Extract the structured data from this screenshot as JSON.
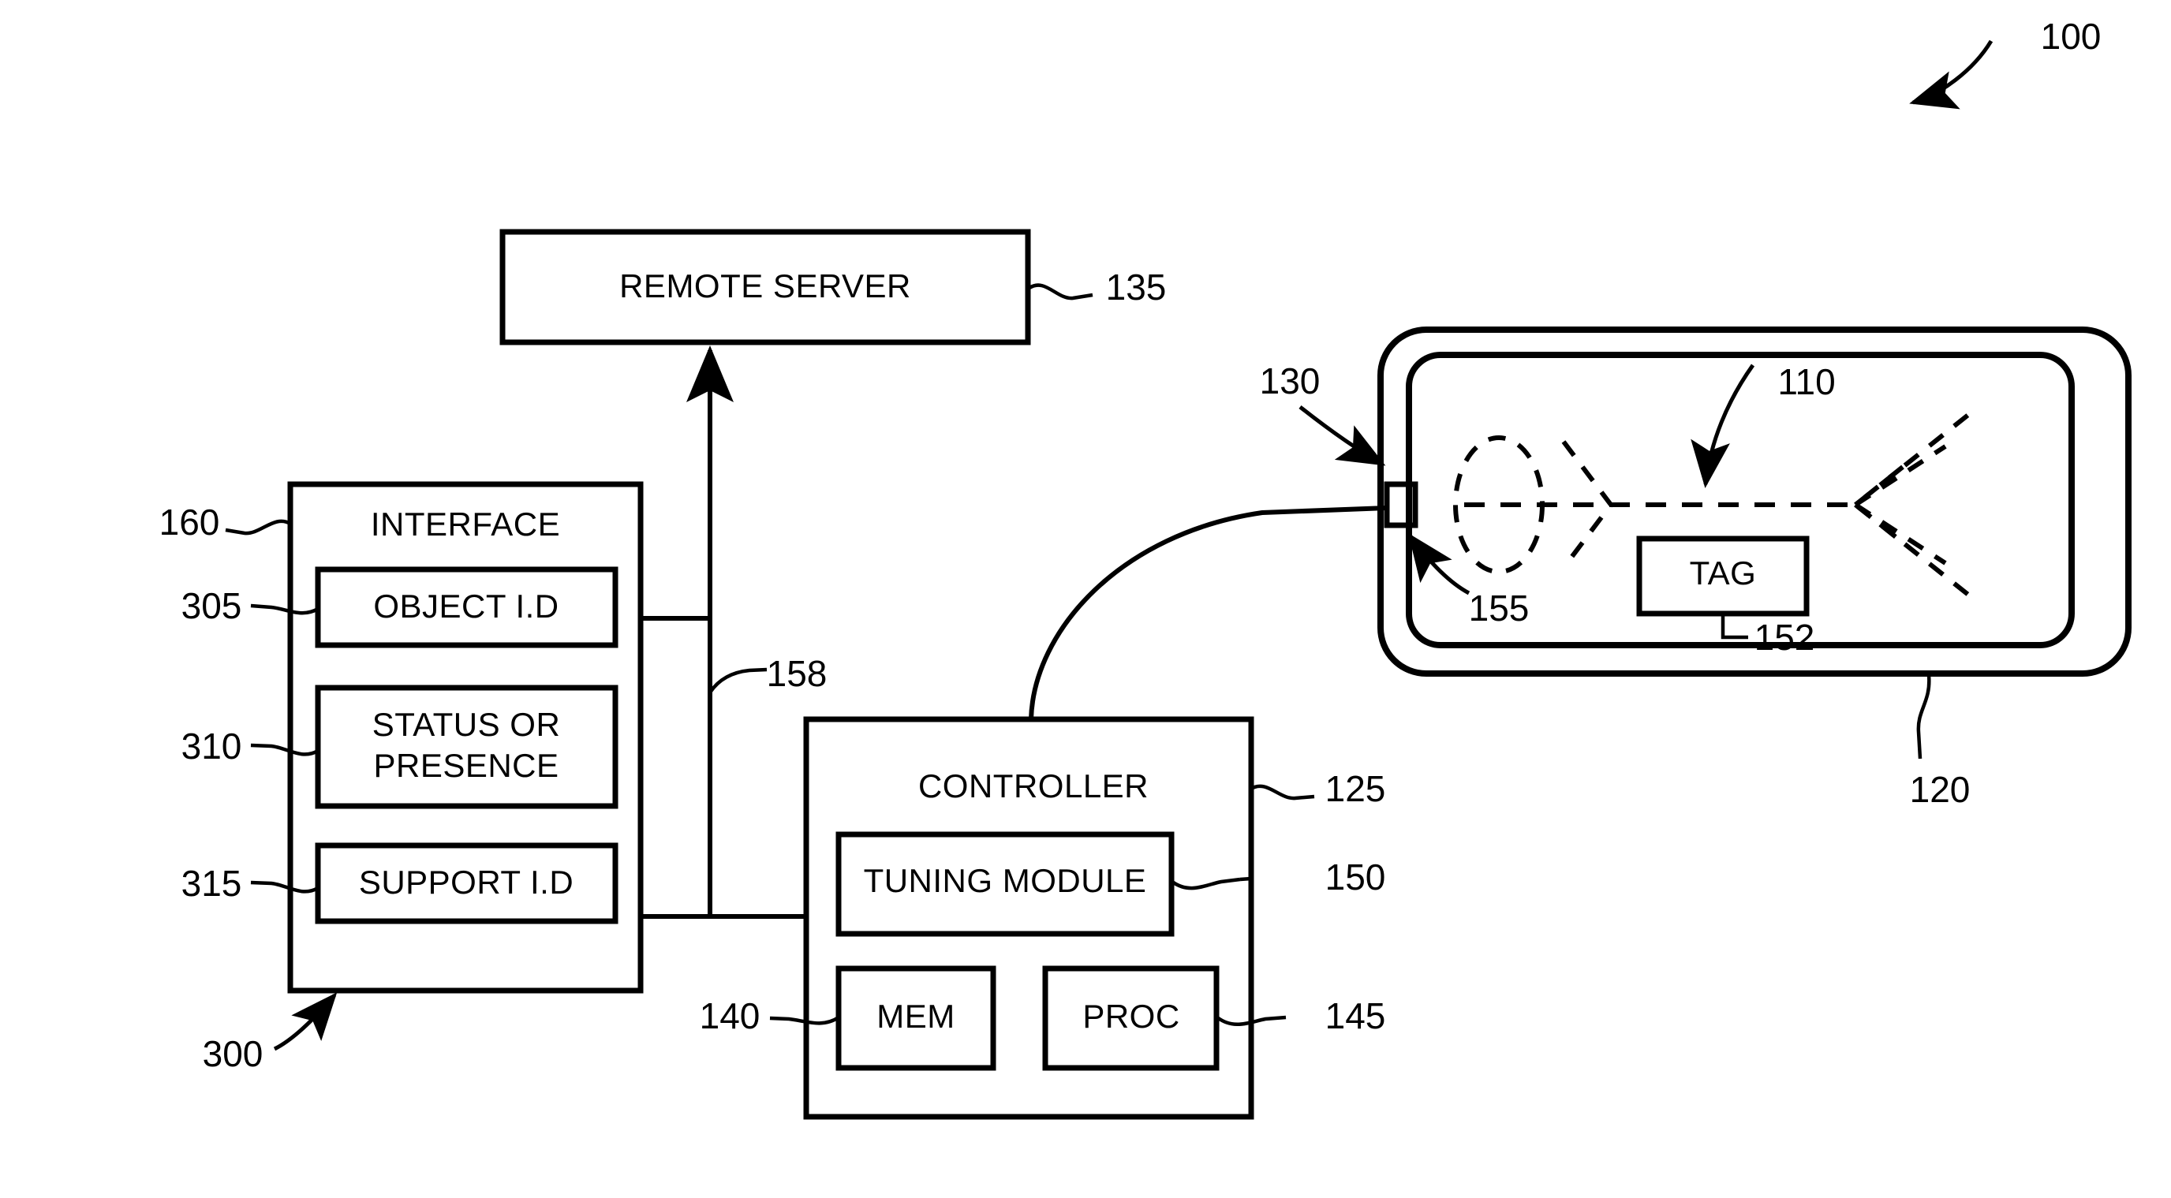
{
  "figure": {
    "title_ref": "100",
    "blocks": {
      "remote_server": {
        "label": "REMOTE SERVER",
        "ref": "135"
      },
      "interface": {
        "label": "INTERFACE",
        "ref": "160",
        "bottom_ref": "300"
      },
      "object_id": {
        "label": "OBJECT I.D",
        "ref": "305"
      },
      "status_or_presence_line1": {
        "label": "STATUS OR"
      },
      "status_or_presence_line2": {
        "label": "PRESENCE"
      },
      "status_or_presence": {
        "ref": "310"
      },
      "support_id": {
        "label": "SUPPORT I.D",
        "ref": "315"
      },
      "controller": {
        "label": "CONTROLLER",
        "ref": "125"
      },
      "tuning_module": {
        "label": "TUNING MODULE",
        "ref": "150"
      },
      "mem": {
        "label": "MEM",
        "ref": "140"
      },
      "proc": {
        "label": "PROC",
        "ref": "145"
      },
      "tag": {
        "label": "TAG",
        "ref": "152"
      },
      "enclosure": {
        "ref": "120"
      },
      "enclosure_wall": {
        "ref": "130"
      },
      "connector": {
        "ref": "155"
      },
      "field_pattern": {
        "ref": "110"
      },
      "bus": {
        "ref": "158"
      }
    },
    "reference_numerals": [
      "100",
      "110",
      "120",
      "125",
      "130",
      "135",
      "140",
      "145",
      "150",
      "152",
      "155",
      "158",
      "160",
      "300",
      "305",
      "310",
      "315"
    ],
    "colors": {
      "ink": "#000000",
      "paper": "#ffffff"
    }
  }
}
